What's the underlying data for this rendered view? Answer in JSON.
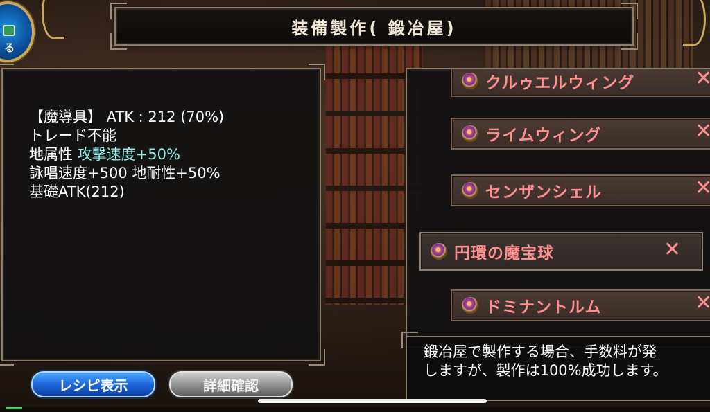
{
  "header": {
    "title": "装備製作( 鍛冶屋)"
  },
  "back_button": {
    "label": "る"
  },
  "detail": {
    "line1": "【魔導具】 ATK : 212 (70%)",
    "line2": "トレード不能",
    "line3_prefix": "地属性 ",
    "line3_highlight": "攻撃速度+50%",
    "line4": "詠唱速度+500 地耐性+50%",
    "line5": "基礎ATK(212)"
  },
  "recipes": [
    {
      "label": "クルゥエルウィング"
    },
    {
      "label": "ライムウィング"
    },
    {
      "label": "センザンシェル"
    },
    {
      "label": "円環の魔宝球"
    },
    {
      "label": "ドミナントルム"
    }
  ],
  "info": {
    "line1": "鍛冶屋で製作する場合、手数料が発",
    "line2": "しますが、製作は100%成功します。"
  },
  "buttons": {
    "recipe": "レシピ表示",
    "details": "詳細確認"
  },
  "icons": {
    "close": "✕"
  },
  "colors": {
    "recipe_text": "#ff8f8f",
    "highlight": "#8ff0ea",
    "primary_button": "#1b62d8"
  }
}
